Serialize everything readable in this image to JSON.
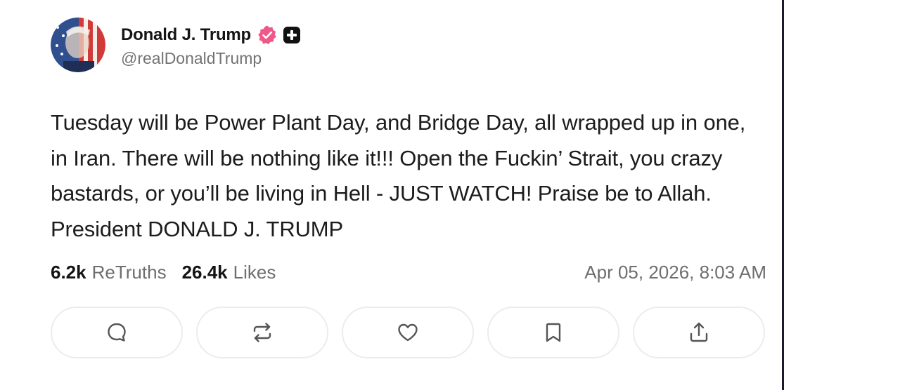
{
  "author": {
    "display_name": "Donald J. Trump",
    "handle": "@realDonaldTrump"
  },
  "post": {
    "text": "Tuesday will be Power Plant Day, and Bridge Day, all wrapped up in one, in Iran. There will be nothing like it!!! Open the Fuckin’ Strait, you crazy bastards, or you’ll be living in Hell - JUST WATCH! Praise be to Allah. President DONALD J. TRUMP",
    "timestamp": "Apr 05, 2026, 8:03 AM"
  },
  "stats": {
    "retruths_count": "6.2k",
    "retruths_label": "ReTruths",
    "likes_count": "26.4k",
    "likes_label": "Likes"
  },
  "actions": [
    {
      "icon": "comment-icon"
    },
    {
      "icon": "retruth-icon"
    },
    {
      "icon": "heart-icon"
    },
    {
      "icon": "bookmark-icon"
    },
    {
      "icon": "share-icon"
    }
  ],
  "colors": {
    "verified_badge": "#f0588a",
    "text_primary": "#141414",
    "text_secondary": "#6e6e6e",
    "button_border": "#ececec"
  }
}
